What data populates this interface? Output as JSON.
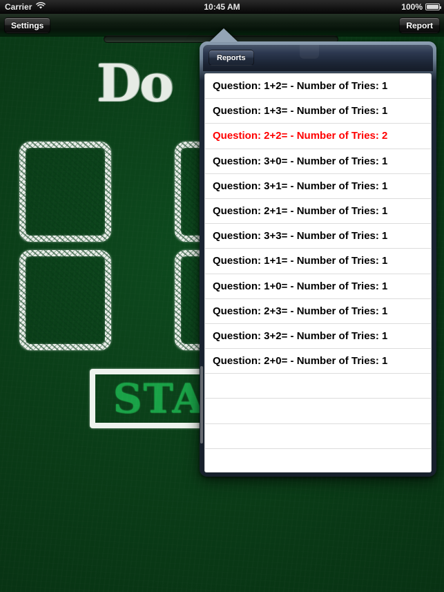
{
  "status_bar": {
    "carrier": "Carrier",
    "wifi_icon": "wifi-icon",
    "time": "10:45 AM",
    "battery_percent": "100%",
    "battery_icon": "battery-full-icon"
  },
  "toolbar": {
    "settings_label": "Settings",
    "report_label": "Report"
  },
  "chalkboard": {
    "title": "Do",
    "start_label": "STA",
    "board_color": "#0a3c17",
    "chalk_color": "#fbfdfa",
    "start_text_color": "#1aa84a"
  },
  "popover": {
    "title": "Reports",
    "highlight_color": "#ff0000",
    "rows": [
      {
        "text": "Question: 1+2= - Number of Tries: 1",
        "highlight": false
      },
      {
        "text": "Question: 1+3= - Number of Tries: 1",
        "highlight": false
      },
      {
        "text": "Question: 2+2= - Number of Tries: 2",
        "highlight": true
      },
      {
        "text": "Question: 3+0= - Number of Tries: 1",
        "highlight": false
      },
      {
        "text": "Question: 3+1= - Number of Tries: 1",
        "highlight": false
      },
      {
        "text": "Question: 2+1= - Number of Tries: 1",
        "highlight": false
      },
      {
        "text": "Question: 3+3= - Number of Tries: 1",
        "highlight": false
      },
      {
        "text": "Question: 1+1= - Number of Tries: 1",
        "highlight": false
      },
      {
        "text": "Question: 1+0= - Number of Tries: 1",
        "highlight": false
      },
      {
        "text": "Question: 2+3= - Number of Tries: 1",
        "highlight": false
      },
      {
        "text": "Question: 3+2= - Number of Tries: 1",
        "highlight": false
      },
      {
        "text": "Question: 2+0= - Number of Tries: 1",
        "highlight": false
      },
      {
        "text": "",
        "highlight": false
      },
      {
        "text": "",
        "highlight": false
      },
      {
        "text": "",
        "highlight": false
      },
      {
        "text": "",
        "highlight": false
      }
    ]
  }
}
